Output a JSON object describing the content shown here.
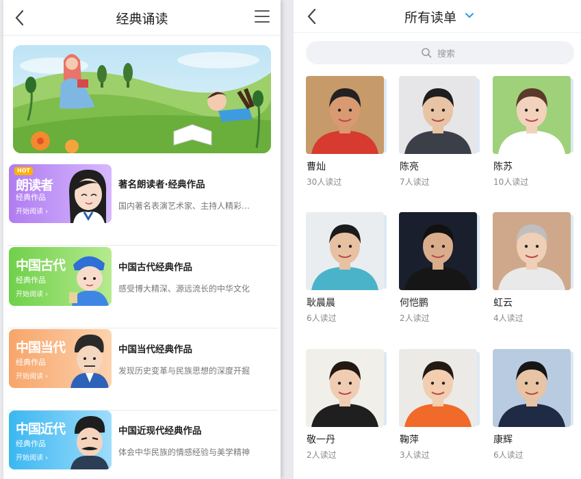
{
  "left": {
    "title": "经典诵读",
    "icons": {
      "back": "chevron-left-icon",
      "menu": "hamburger-menu-icon"
    },
    "categories": [
      {
        "card_title": "朗读者",
        "badge": "HOT",
        "card_subtitle": "经典作品",
        "card_button": "开始阅读 ›",
        "name": "著名朗读者·经典作品",
        "desc": "国内著名表演艺术家、主持人精彩…",
        "color_from": "#b07cf0",
        "color_to": "#d7b8ff"
      },
      {
        "card_title": "中国古代",
        "card_subtitle": "经典作品",
        "card_button": "开始阅读 ›",
        "name": "中国古代经典作品",
        "desc": "感受博大精深、源远流长的中华文化",
        "color_from": "#6fd04a",
        "color_to": "#b6ea8e"
      },
      {
        "card_title": "中国当代",
        "card_subtitle": "经典作品",
        "card_button": "开始阅读 ›",
        "name": "中国当代经典作品",
        "desc": "发现历史变革与民族思想的深度开掘",
        "color_from": "#f7a56a",
        "color_to": "#fcd2ad"
      },
      {
        "card_title": "中国近代",
        "card_subtitle": "经典作品",
        "card_button": "开始阅读 ›",
        "name": "中国近现代经典作品",
        "desc": "体会中华民族的情感经验与美学精神",
        "color_from": "#3ab7f1",
        "color_to": "#9edcfb"
      }
    ]
  },
  "right": {
    "title": "所有读单",
    "accent": "#2a9be8",
    "icons": {
      "back": "chevron-left-icon",
      "dropdown": "chevron-down-icon",
      "search": "search-icon"
    },
    "search_placeholder": "搜索",
    "readers": [
      {
        "name": "曹灿",
        "count": "30人读过",
        "bg": "#c79a6a",
        "skin": "#d99a72",
        "hair": "#222",
        "cloth": "#d73a2e"
      },
      {
        "name": "陈亮",
        "count": "7人读过",
        "bg": "#e6e6e8",
        "skin": "#e8c3a4",
        "hair": "#1e1e1e",
        "cloth": "#3b3f47"
      },
      {
        "name": "陈苏",
        "count": "10人读过",
        "bg": "#9fd07a",
        "skin": "#f2d2bc",
        "hair": "#5a3a2a",
        "cloth": "#ffffff"
      },
      {
        "name": "耿晨晨",
        "count": "6人读过",
        "bg": "#e9edf0",
        "skin": "#e8c0a2",
        "hair": "#1b1b1b",
        "cloth": "#4ab3c9"
      },
      {
        "name": "何恺鹏",
        "count": "2人读过",
        "bg": "#1a1f2e",
        "skin": "#d9ad8c",
        "hair": "#111",
        "cloth": "#161616"
      },
      {
        "name": "虹云",
        "count": "4人读过",
        "bg": "#cfa88c",
        "skin": "#efcfb5",
        "hair": "#bfbfbf",
        "cloth": "#e9e9e9"
      },
      {
        "name": "敬一丹",
        "count": "2人读过",
        "bg": "#f1efe9",
        "skin": "#f0cdb2",
        "hair": "#241812",
        "cloth": "#1f1f1f"
      },
      {
        "name": "鞠萍",
        "count": "3人读过",
        "bg": "#eceae6",
        "skin": "#f2cdb0",
        "hair": "#241a14",
        "cloth": "#f06a2a"
      },
      {
        "name": "康辉",
        "count": "6人读过",
        "bg": "#b9cbe0",
        "skin": "#e8c3a4",
        "hair": "#161616",
        "cloth": "#1f2a44"
      }
    ]
  }
}
